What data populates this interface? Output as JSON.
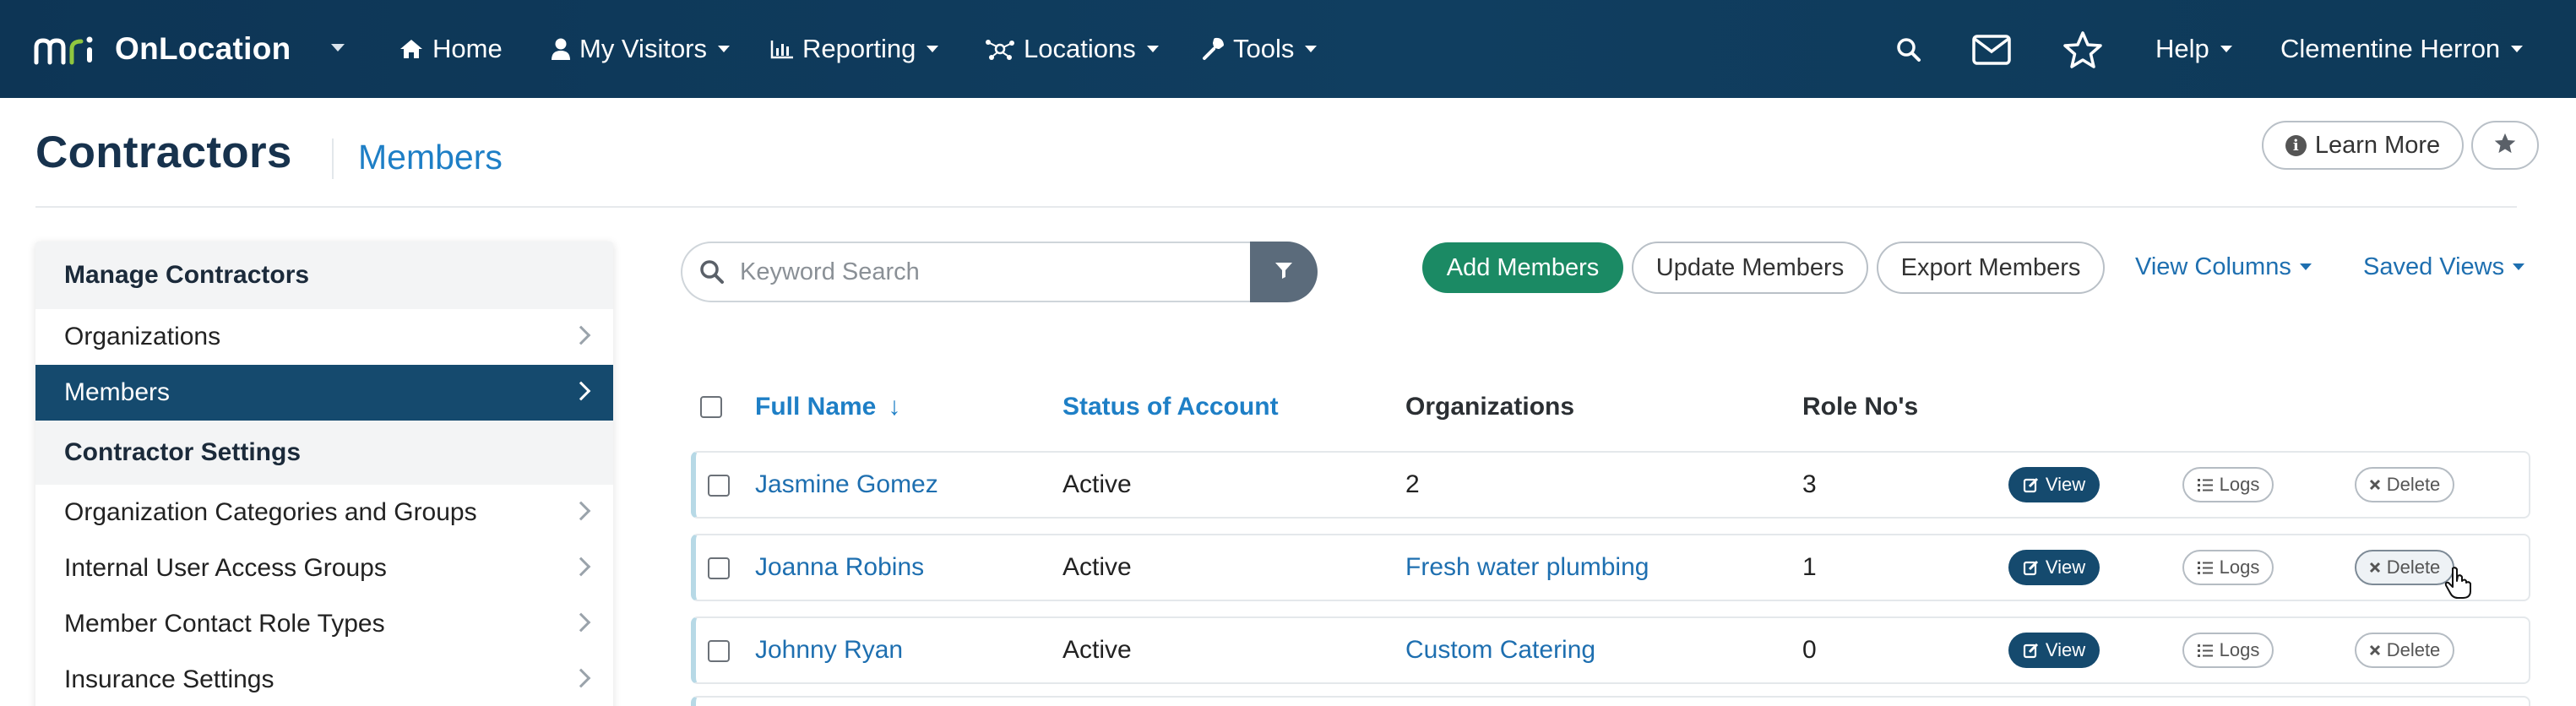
{
  "app": {
    "name": "OnLocation",
    "brand_mark": "mri"
  },
  "nav": {
    "items": [
      {
        "label": "Home",
        "icon": "home-icon"
      },
      {
        "label": "My Visitors",
        "icon": "user-icon"
      },
      {
        "label": "Reporting",
        "icon": "bar-chart-icon"
      },
      {
        "label": "Locations",
        "icon": "network-icon"
      },
      {
        "label": "Tools",
        "icon": "wrench-icon"
      }
    ],
    "help_label": "Help",
    "user_name": "Clementine Herron"
  },
  "page": {
    "title": "Contractors",
    "subtitle": "Members",
    "learn_more_label": "Learn More"
  },
  "sidebar": {
    "section1": "Manage Contractors",
    "manage_items": [
      {
        "label": "Organizations",
        "active": false
      },
      {
        "label": "Members",
        "active": true
      }
    ],
    "section2": "Contractor Settings",
    "settings_items": [
      {
        "label": "Organization Categories and Groups"
      },
      {
        "label": "Internal User Access Groups"
      },
      {
        "label": "Member Contact Role Types"
      },
      {
        "label": "Insurance Settings"
      }
    ]
  },
  "toolbar": {
    "search_placeholder": "Keyword Search",
    "add_label": "Add Members",
    "update_label": "Update Members",
    "export_label": "Export Members",
    "view_columns_label": "View Columns",
    "saved_views_label": "Saved Views"
  },
  "table": {
    "columns": {
      "full_name": "Full Name",
      "sort_indicator": "↓",
      "status": "Status of Account",
      "organizations": "Organizations",
      "role_nos": "Role No's"
    },
    "actions": {
      "view": "View",
      "logs": "Logs",
      "delete": "Delete"
    },
    "rows": [
      {
        "name": "Jasmine Gomez",
        "status": "Active",
        "organizations": "2",
        "role_nos": "3"
      },
      {
        "name": "Joanna Robins",
        "status": "Active",
        "organizations": "Fresh water plumbing",
        "role_nos": "1"
      },
      {
        "name": "Johnny Ryan",
        "status": "Active",
        "organizations": "Custom Catering",
        "role_nos": "0"
      }
    ]
  },
  "colors": {
    "nav_bg": "#0d3555",
    "accent_blue": "#1e7fc6",
    "active_sidebar": "#154a6e",
    "add_green": "#1b8a64"
  }
}
